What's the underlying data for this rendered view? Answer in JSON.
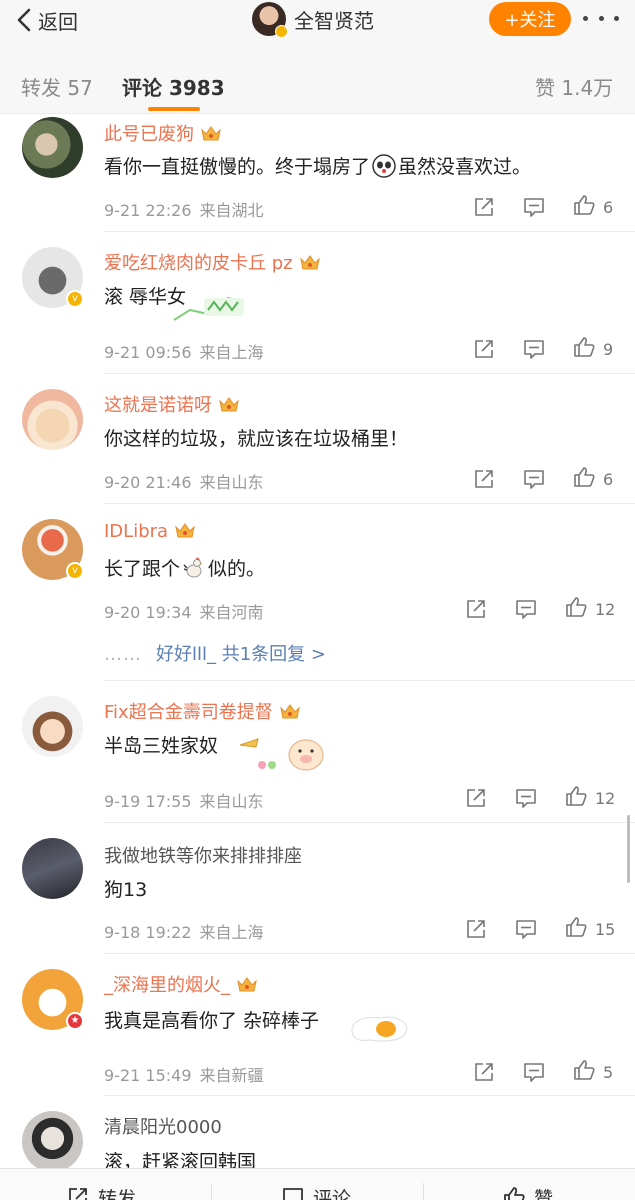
{
  "nav": {
    "back_label": "返回",
    "profile_name": "全智贤范",
    "follow_label": "+关注"
  },
  "tabs": {
    "repost": "转发 57",
    "comments": "评论 3983",
    "likes": "赞 1.4万"
  },
  "comments": [
    {
      "user": "此号已废狗",
      "text_a": "看你一直挺傲慢的。终于塌房了",
      "text_b": "虽然没喜欢过。",
      "time": "9-21 22:26",
      "location": "来自湖北",
      "likes": "6"
    },
    {
      "user": "爱吃红烧肉的皮卡丘 pz",
      "text": "滚 辱华女",
      "time": "9-21 09:56",
      "location": "来自上海",
      "likes": "9"
    },
    {
      "user": "这就是诺诺呀",
      "text": "你这样的垃圾，就应该在垃圾桶里！",
      "time": "9-20 21:46",
      "location": "来自山东",
      "likes": "6"
    },
    {
      "user": "IDLibra",
      "text_a": "长了跟个",
      "text_b": "似的。",
      "time": "9-20 19:34",
      "location": "来自河南",
      "likes": "12",
      "reply_dots": "……",
      "reply_link": "好好lll_  共1条回复 >"
    },
    {
      "user": "Fix超合金壽司卷提督",
      "text": "半岛三姓家奴",
      "time": "9-19 17:55",
      "location": "来自山东",
      "likes": "12"
    },
    {
      "user": "我做地铁等你来排排排座",
      "text": "狗13",
      "time": "9-18 19:22",
      "location": "来自上海",
      "likes": "15"
    },
    {
      "user": "_深海里的烟火_",
      "text": "我真是高看你了  杂碎棒子",
      "time": "9-21 15:49",
      "location": "来自新疆",
      "likes": "5"
    },
    {
      "user": "清晨阳光0000",
      "text": "滚，赶紧滚回韩国"
    }
  ],
  "bottom": {
    "repost": "转发",
    "comment": "评论",
    "like": "赞"
  },
  "colors": {
    "accent": "#ff8200",
    "username": "#eb7350",
    "link": "#5b7fb5"
  }
}
